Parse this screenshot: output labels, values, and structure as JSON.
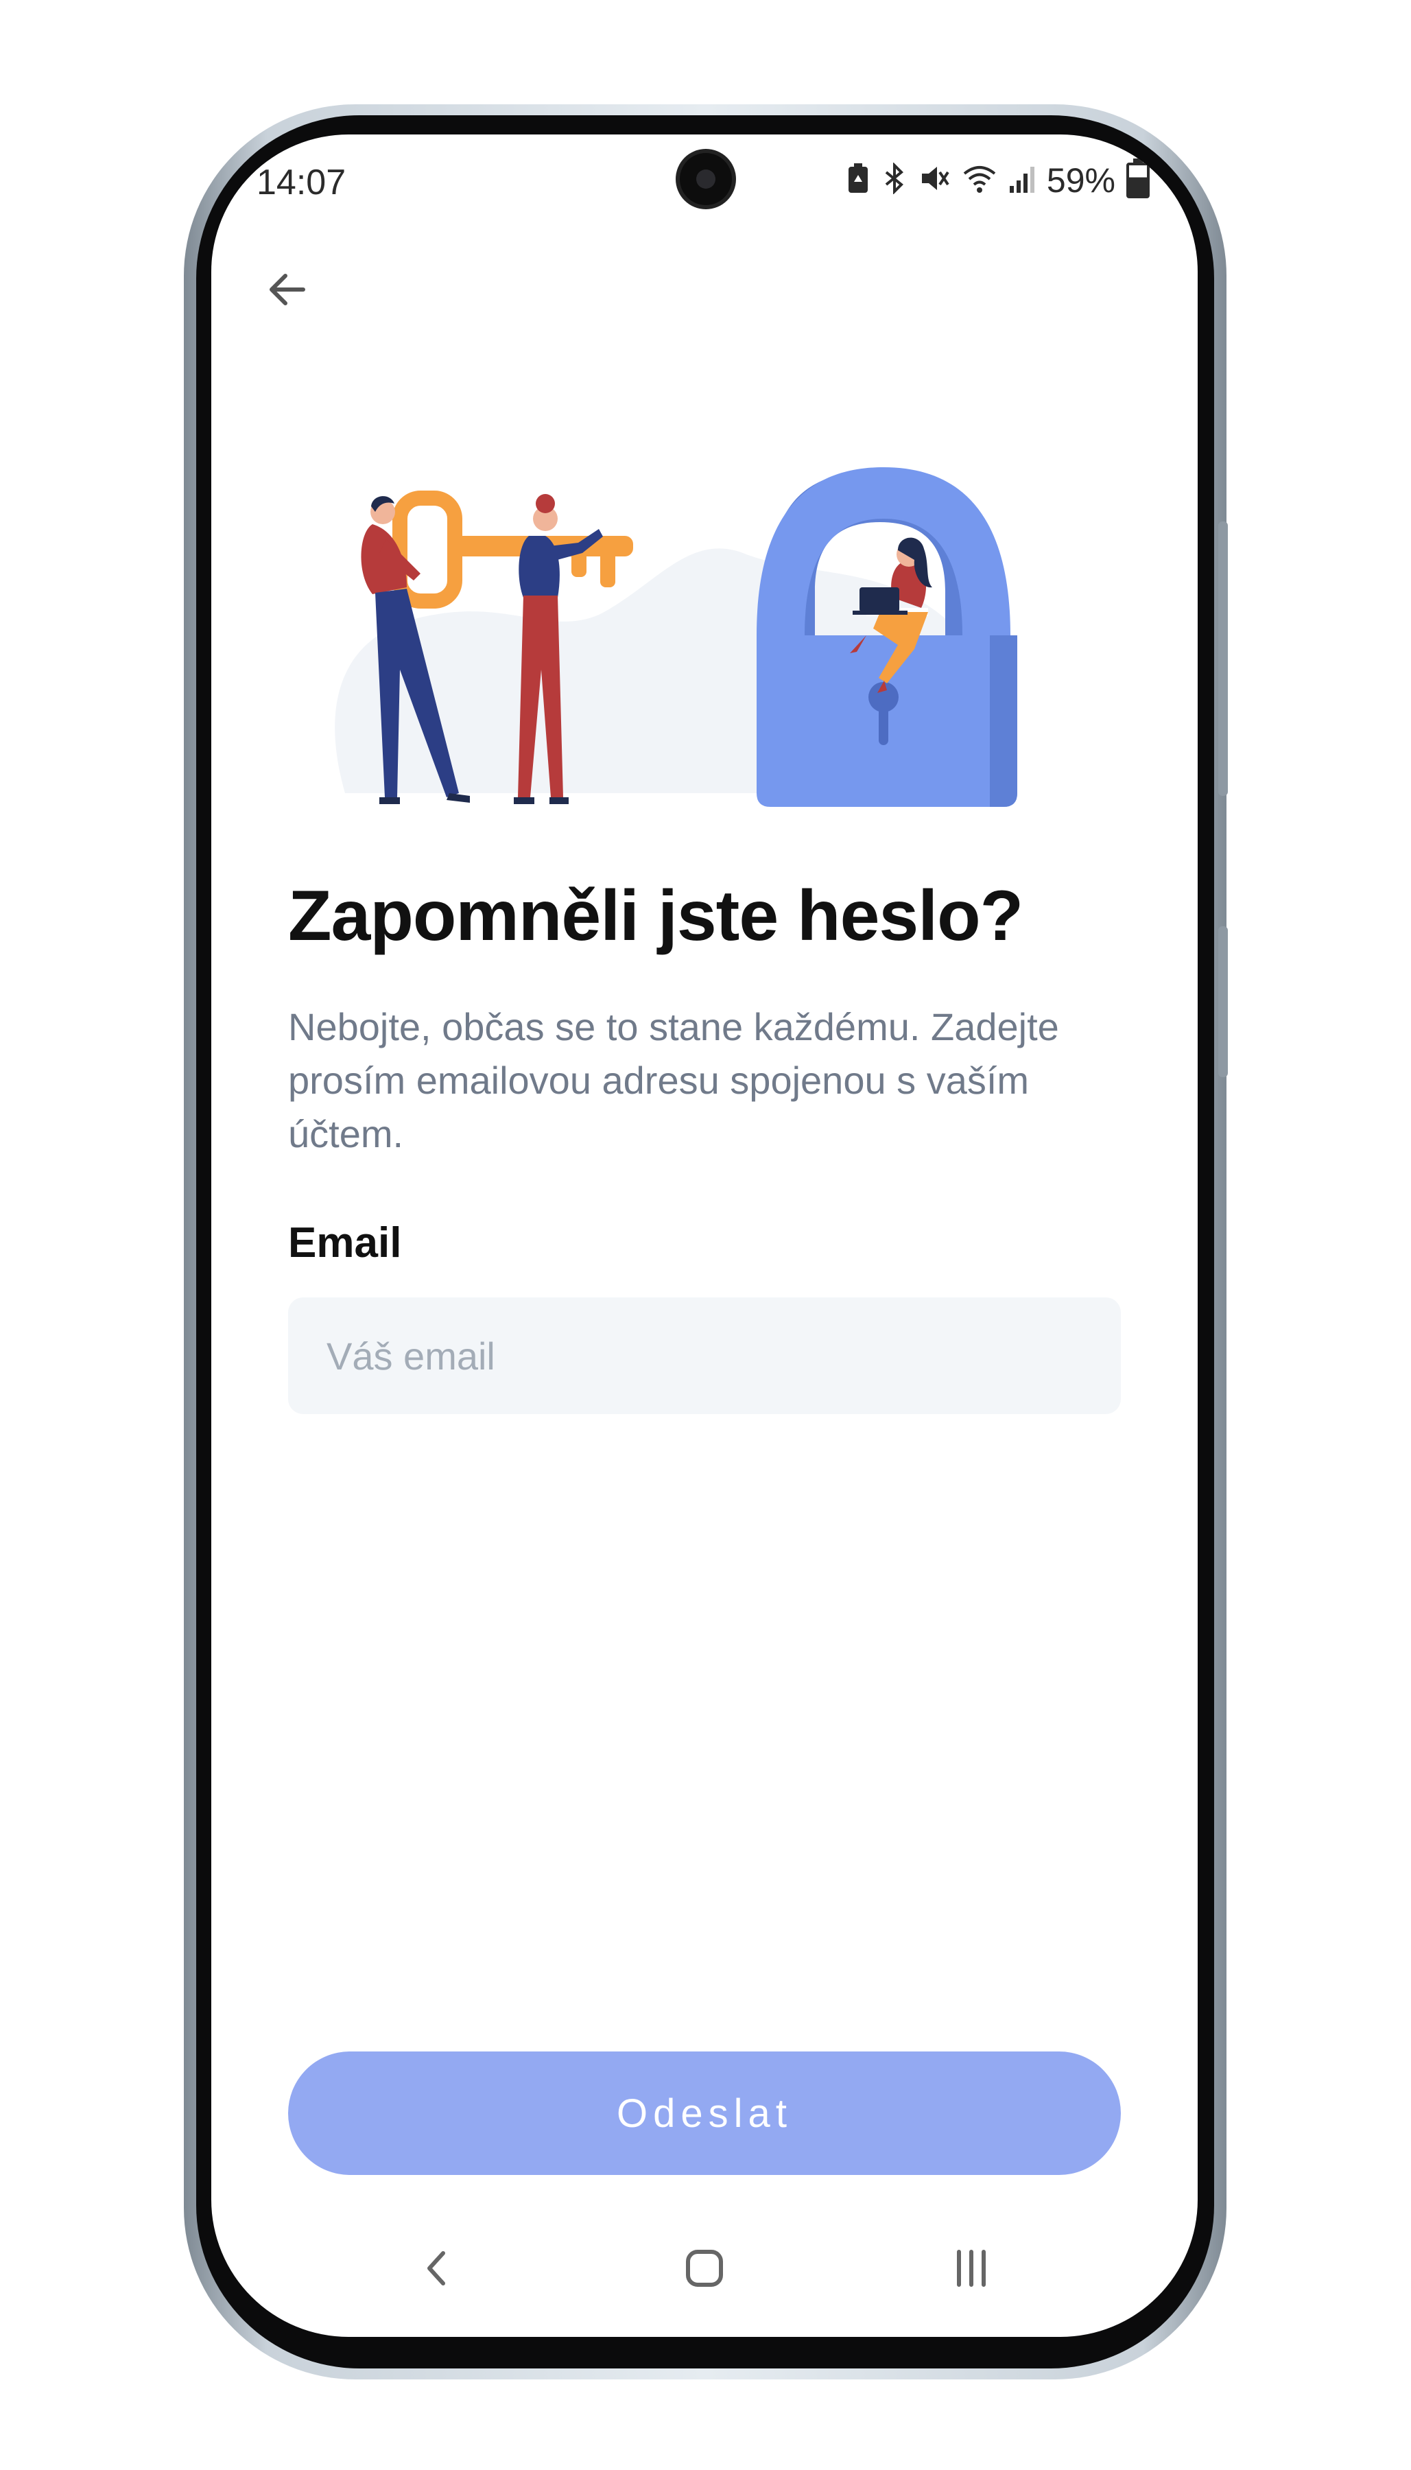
{
  "status_bar": {
    "time": "14:07",
    "battery_percent": "59%",
    "icons": [
      "battery-saver-icon",
      "bluetooth-icon",
      "mute-icon",
      "wifi-icon",
      "signal-icon",
      "battery-icon"
    ]
  },
  "header": {
    "back_icon": "arrow-left-icon"
  },
  "illustration": {
    "description_icon": "key-lock-illustration"
  },
  "content": {
    "title": "Zapomněli jste heslo?",
    "description": "Nebojte, občas se to stane každému. Zadejte prosím emailovou adresu spojenou s vaším účtem.",
    "email_label": "Email",
    "email_placeholder": "Váš email",
    "email_value": ""
  },
  "actions": {
    "submit_label": "Odeslat"
  },
  "navigation": {
    "back_icon": "nav-back-icon",
    "home_icon": "nav-home-icon",
    "recents_icon": "nav-recents-icon"
  },
  "colors": {
    "accent": "#93a9f2",
    "lock": "#7698ee",
    "key": "#f6a040",
    "text_secondary": "#707a8a"
  }
}
